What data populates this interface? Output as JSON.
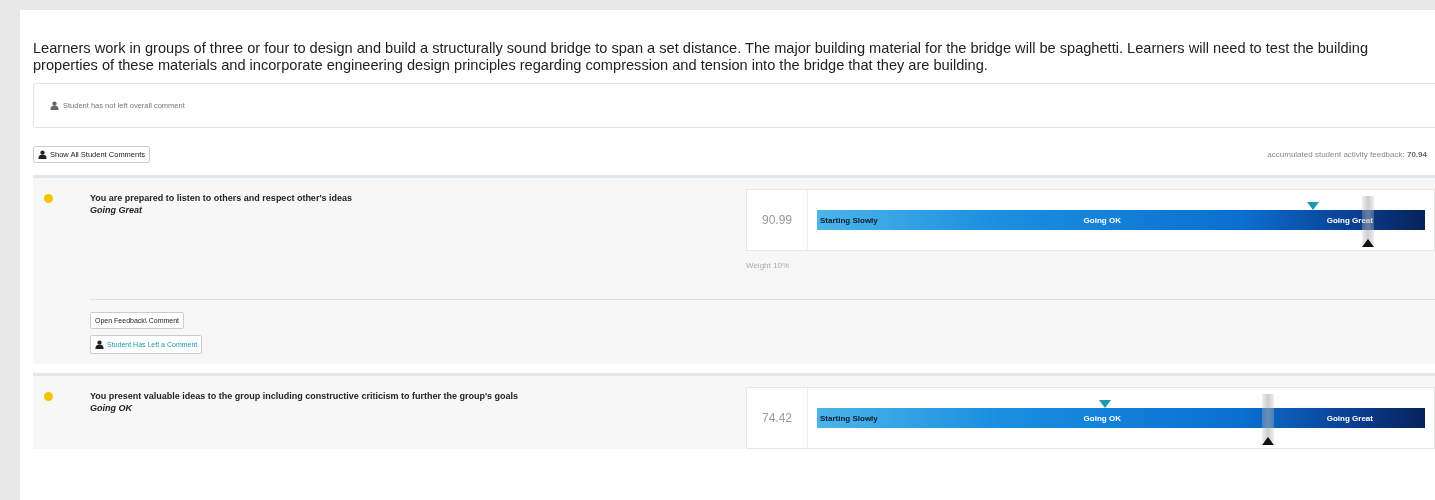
{
  "description": "Learners work in groups of three or four to design and build a structurally sound bridge to span a set distance. The major building material for the bridge will be spaghetti. Learners will need to test the building properties of these materials and incorporate engineering design principles regarding compression and tension into the bridge that they are building.",
  "overall_comment": "Student has not left overall comment",
  "show_comments_button": "Show All Student Comments",
  "accumulated": {
    "label": "accumulated student activity feedback:",
    "value": "70.94"
  },
  "criteria": [
    {
      "color": "#f5c400",
      "title": "You are prepared to listen to others and respect other's ideas",
      "rating": "Going Great",
      "score": "90.99",
      "scale": [
        "Starting Slowly",
        "Going OK",
        "Going Great"
      ],
      "student_marker": {
        "level": 0.816
      },
      "teacher_marker": {
        "level": 0.907
      },
      "weight": "Weight 10%",
      "buttons": [
        {
          "kind": "plain",
          "label": "Open Feedback\\ Comment"
        },
        {
          "kind": "student",
          "label": "Student Has Left a Comment"
        }
      ]
    },
    {
      "color": "#f5c400",
      "title": "You present valuable ideas to the group including constructive criticism to further the group's goals",
      "rating": "Going OK",
      "score": "74.42",
      "scale": [
        "Starting Slowly",
        "Going OK",
        "Going Great"
      ],
      "student_marker": {
        "level": 0.473
      },
      "teacher_marker": {
        "level": 0.741
      }
    }
  ]
}
